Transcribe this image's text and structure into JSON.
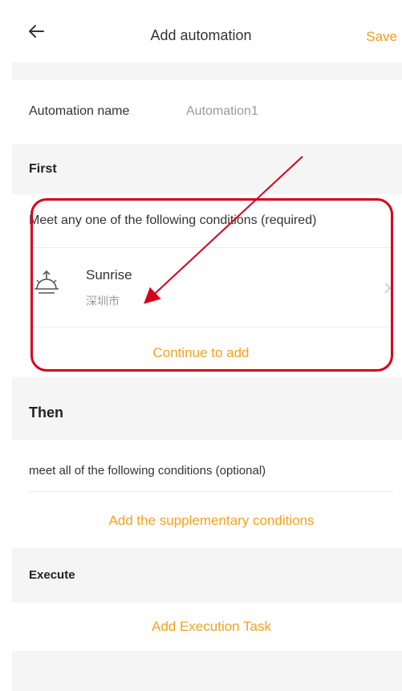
{
  "header": {
    "title": "Add automation",
    "save_label": "Save"
  },
  "automation": {
    "name_label": "Automation name",
    "name_value": "Automation1"
  },
  "first": {
    "title": "First",
    "condition_rule": "Meet any one of the following conditions (required)",
    "condition": {
      "title": "Sunrise",
      "location": "深圳市"
    },
    "continue_label": "Continue to add"
  },
  "then": {
    "title": "Then",
    "condition_rule": "meet all of the following conditions (optional)",
    "add_label": "Add the supplementary conditions"
  },
  "execute": {
    "title": "Execute",
    "add_label": "Add Execution Task"
  },
  "colors": {
    "accent": "#f5a11c",
    "annotation": "#d6001c",
    "background": "#f5f5f5"
  },
  "icons": [
    "back-arrow-icon",
    "sunrise-icon",
    "chevron-right-icon"
  ]
}
